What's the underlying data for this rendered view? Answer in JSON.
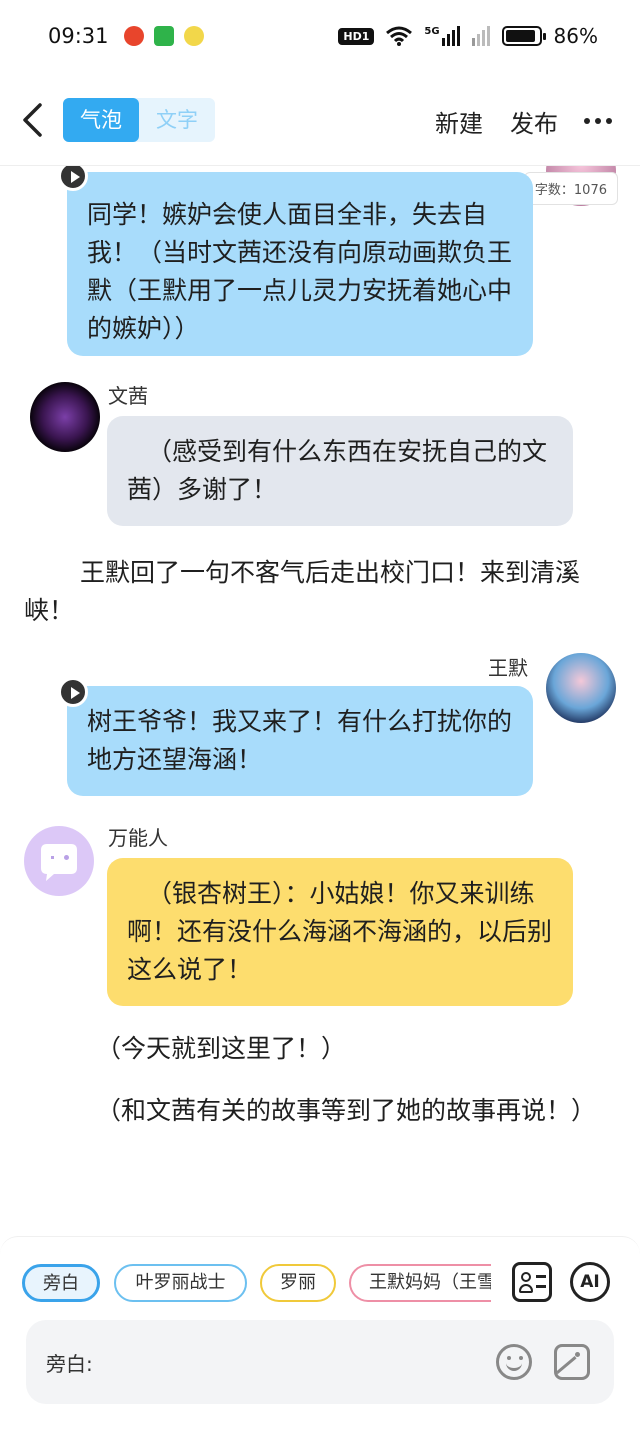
{
  "status_bar": {
    "time": "09:31",
    "hd": "HD1",
    "signal": "5G",
    "battery": "86%"
  },
  "header": {
    "tabs": [
      {
        "label": "气泡",
        "active": true
      },
      {
        "label": "文字",
        "active": false
      }
    ],
    "new_label": "新建",
    "publish_label": "发布"
  },
  "word_count": "字数：1076",
  "messages": [
    {
      "type": "bubble",
      "side": "right",
      "color": "blue",
      "text": "同学！嫉妒会使人面目全非，失去自我！（当时文茜还没有向原动画欺负王默（王默用了一点儿灵力安抚着她心中的嫉妒））"
    },
    {
      "type": "bubble",
      "side": "left",
      "color": "gray",
      "speaker": "文茜",
      "text": "（感受到有什么东西在安抚自己的文茜）多谢了！"
    },
    {
      "type": "narration",
      "text": "王默回了一句不客气后走出校门口！来到清溪峡！"
    },
    {
      "type": "bubble",
      "side": "right",
      "color": "blue",
      "speaker": "王默",
      "text": "树王爷爷！我又来了！有什么打扰你的地方还望海涵！"
    },
    {
      "type": "bubble",
      "side": "left",
      "color": "yellow",
      "speaker": "万能人",
      "text": "（银杏树王）：小姑娘！你又来训练啊！还有没什么海涵不海涵的，以后别这么说了！"
    },
    {
      "type": "narration",
      "text": "（今天就到这里了！）"
    },
    {
      "type": "narration",
      "text": "（和文茜有关的故事等到了她的故事再说！）"
    }
  ],
  "characters": [
    {
      "label": "旁白",
      "color": "#3aa3ea",
      "selected": true
    },
    {
      "label": "叶罗丽战士",
      "color": "#6cc0f0",
      "selected": false
    },
    {
      "label": "罗丽",
      "color": "#f0c93a",
      "selected": false
    },
    {
      "label": "王默妈妈（王雪",
      "color": "#ee8fa6",
      "selected": false
    }
  ],
  "tools": {
    "ai_label": "AI"
  },
  "input": {
    "label": "旁白:",
    "placeholder": ""
  }
}
